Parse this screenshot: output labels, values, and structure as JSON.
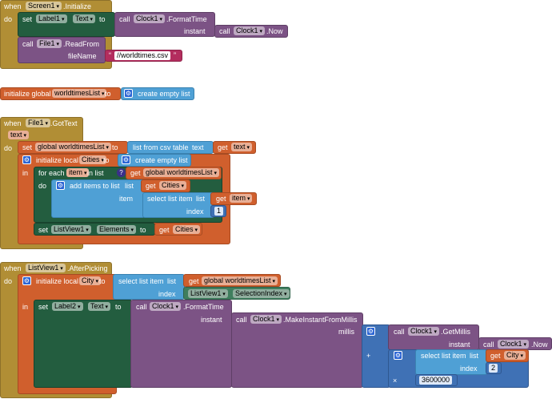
{
  "b1": {
    "when": "when",
    "screen": "Screen1",
    "event": ".Initialize",
    "do": "do",
    "set": "set",
    "label": "Label1",
    "prop": "Text",
    "to": "to",
    "call": "call",
    "clock": "Clock1",
    "format": ".FormatTime",
    "instant": "instant",
    "call2": "call",
    "clock2": "Clock1",
    "now": ".Now",
    "call3": "call",
    "file": "File1",
    "readfrom": ".ReadFrom",
    "filename": "fileName",
    "path": "//worldtimes.csv"
  },
  "b2": {
    "init": "initialize global",
    "var": "worldtimesList",
    "to": "to",
    "create": "create empty list"
  },
  "b3": {
    "when": "when",
    "file": "File1",
    "event": ".GotText",
    "param": "text",
    "do": "do",
    "set": "set",
    "gvar": "global worldtimesList",
    "to": "to",
    "csv": "list from csv table",
    "textlbl": "text",
    "get": "get",
    "getvar": "text",
    "initlocal": "initialize local",
    "local": "Cities",
    "to2": "to",
    "create": "create empty list",
    "in": "in",
    "foreach": "for each",
    "item": "item",
    "inlist": "in list",
    "get2": "get",
    "gvar2": "global worldtimesList",
    "do2": "do",
    "additems": "add items to list",
    "list": "list",
    "get3": "get",
    "cities": "Cities",
    "itemlbl": "item",
    "select": "select list item",
    "list2": "list",
    "get4": "get",
    "item2": "item",
    "index": "index",
    "one": "1",
    "set2": "set",
    "lv": "ListView1",
    "elements": "Elements",
    "to3": "to",
    "get5": "get",
    "cities2": "Cities"
  },
  "b4": {
    "when": "when",
    "lv": "ListView1",
    "event": ".AfterPicking",
    "do": "do",
    "initlocal": "initialize local",
    "city": "City",
    "to": "to",
    "select": "select list item",
    "list": "list",
    "get": "get",
    "gvar": "global worldtimesList",
    "index": "index",
    "lv2": "ListView1",
    "selidx": "SelectionIndex",
    "in": "in",
    "set": "set",
    "label": "Label2",
    "prop": "Text",
    "to2": "to",
    "call": "call",
    "clock": "Clock1",
    "format": ".FormatTime",
    "instant": "instant",
    "call2": "call",
    "clock2": "Clock1",
    "mkinst": ".MakeInstantFromMillis",
    "millis": "millis",
    "call3": "call",
    "clock3": "Clock1",
    "getmillis": ".GetMillis",
    "instant2": "instant",
    "call4": "call",
    "clock4": "Clock1",
    "now": ".Now",
    "plus": "+",
    "select2": "select list item",
    "list2": "list",
    "get2": "get",
    "city2": "City",
    "index2": "index",
    "two": "2",
    "times": "×",
    "factor": "3600000"
  },
  "colors": {
    "event": "#b18e35",
    "variable": "#d05f2d",
    "component": "#7c5385",
    "list": "#4fa0d5",
    "control": "#235d3f",
    "text": "#b32d5e",
    "math": "#3f71b5"
  }
}
